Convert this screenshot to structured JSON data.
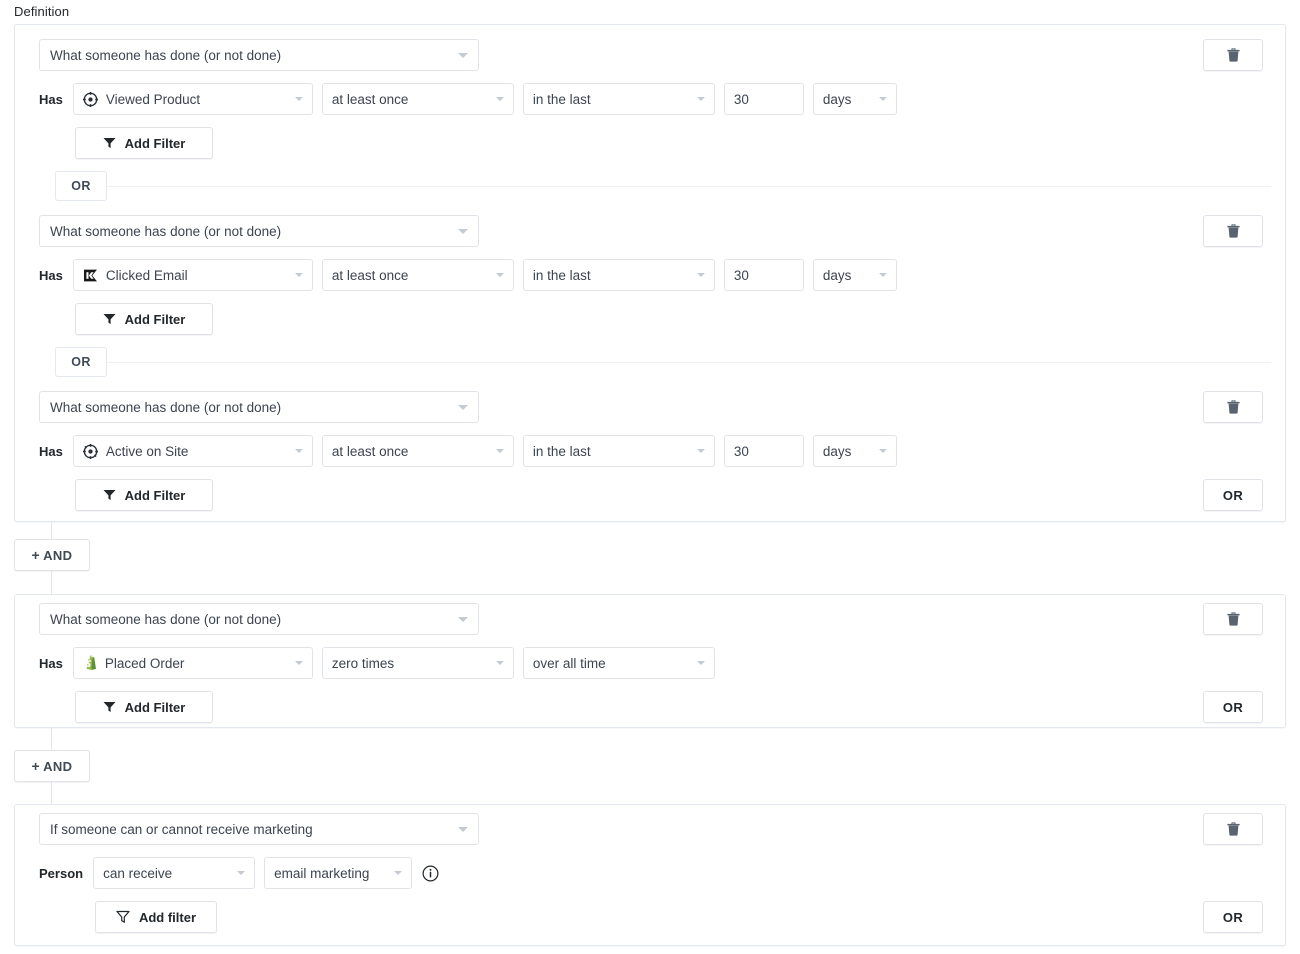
{
  "section": {
    "label": "Definition"
  },
  "groups": [
    {
      "id": "group-1",
      "conditions": [
        {
          "type_label": "What someone has done (or not done)",
          "prefix_label": "Has",
          "metric_icon": "target-icon",
          "metric": "Viewed Product",
          "frequency": "at least once",
          "timeframe": "in the last",
          "amount": "30",
          "unit": "days",
          "add_filter_label": "Add Filter",
          "delete_label": "delete-icon"
        },
        {
          "type_label": "What someone has done (or not done)",
          "prefix_label": "Has",
          "metric_icon": "klaviyo-flag-icon",
          "metric": "Clicked Email",
          "frequency": "at least once",
          "timeframe": "in the last",
          "amount": "30",
          "unit": "days",
          "add_filter_label": "Add Filter",
          "delete_label": "delete-icon"
        },
        {
          "type_label": "What someone has done (or not done)",
          "prefix_label": "Has",
          "metric_icon": "target-icon",
          "metric": "Active on Site",
          "frequency": "at least once",
          "timeframe": "in the last",
          "amount": "30",
          "unit": "days",
          "add_filter_label": "Add Filter",
          "delete_label": "delete-icon"
        }
      ],
      "or_separator_label": "OR",
      "or_button_label": "OR"
    },
    {
      "id": "group-2",
      "conditions": [
        {
          "type_label": "What someone has done (or not done)",
          "prefix_label": "Has",
          "metric_icon": "shopify-icon",
          "metric": "Placed Order",
          "frequency": "zero times",
          "timeframe": "over all time",
          "add_filter_label": "Add Filter",
          "delete_label": "delete-icon"
        }
      ],
      "or_button_label": "OR"
    },
    {
      "id": "group-3",
      "conditions": [
        {
          "type_label": "If someone can or cannot receive marketing",
          "prefix_label": "Person",
          "consent": "can receive",
          "channel": "email marketing",
          "info_icon": "info-icon",
          "add_filter_label": "Add filter",
          "delete_label": "delete-icon"
        }
      ],
      "or_button_label": "OR"
    }
  ],
  "and_buttons": [
    {
      "plus": "+",
      "label": "AND"
    },
    {
      "plus": "+",
      "label": "AND"
    }
  ],
  "colors": {
    "border": "#e3e8ee",
    "field_border": "#e0e4e8",
    "text": "#22272b",
    "muted": "#3c4450",
    "shopify_green": "#95bf47"
  }
}
